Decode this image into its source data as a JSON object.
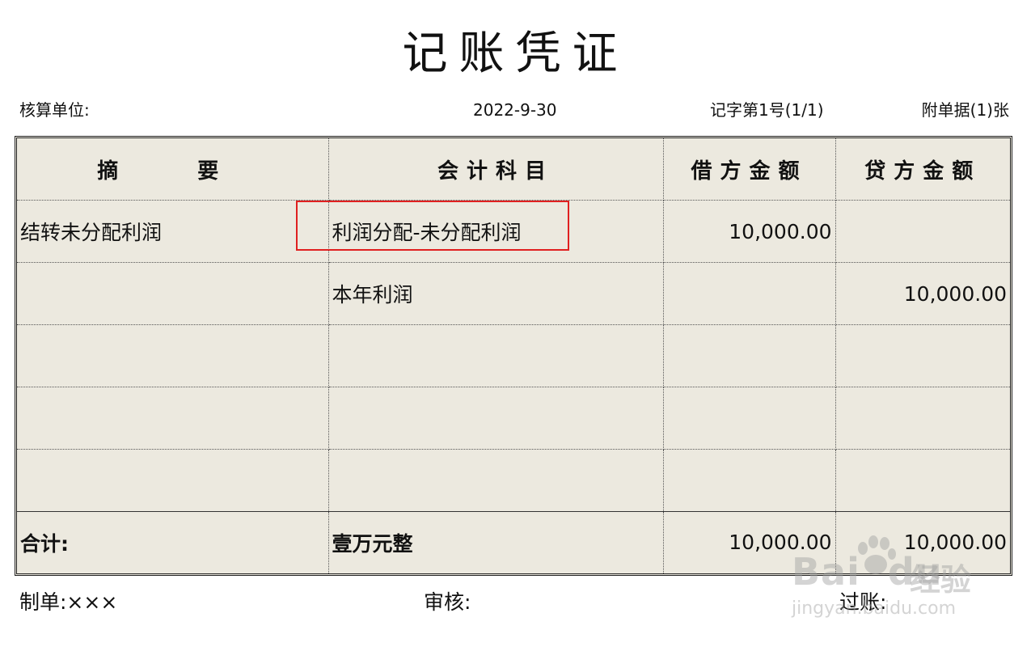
{
  "title": "记账凭证",
  "header": {
    "unit_label": "核算单位:",
    "date": "2022-9-30",
    "voucher_no": "记字第1号(1/1)",
    "attachments": "附单据(1)张"
  },
  "table": {
    "columns": [
      "摘　要",
      "会计科目",
      "借方金额",
      "贷方金额"
    ],
    "rows": [
      {
        "summary": "结转未分配利润",
        "account": "利润分配-未分配利润",
        "debit": "10,000.00",
        "credit": ""
      },
      {
        "summary": "",
        "account": "本年利润",
        "debit": "",
        "credit": "10,000.00"
      },
      {
        "summary": "",
        "account": "",
        "debit": "",
        "credit": ""
      },
      {
        "summary": "",
        "account": "",
        "debit": "",
        "credit": ""
      },
      {
        "summary": "",
        "account": "",
        "debit": "",
        "credit": ""
      }
    ],
    "total": {
      "label": "合计:",
      "amount_words": "壹万元整",
      "debit": "10,000.00",
      "credit": "10,000.00"
    }
  },
  "footer": {
    "maker": "制单:×××",
    "reviewer": "审核:",
    "poster": "过账:"
  },
  "highlight_color": "#e02020",
  "background_color": "#ece9df",
  "watermark": {
    "logo": "Bai",
    "logo_suffix": "du",
    "cn": "经验",
    "url": "jingyan.baidu.com"
  }
}
